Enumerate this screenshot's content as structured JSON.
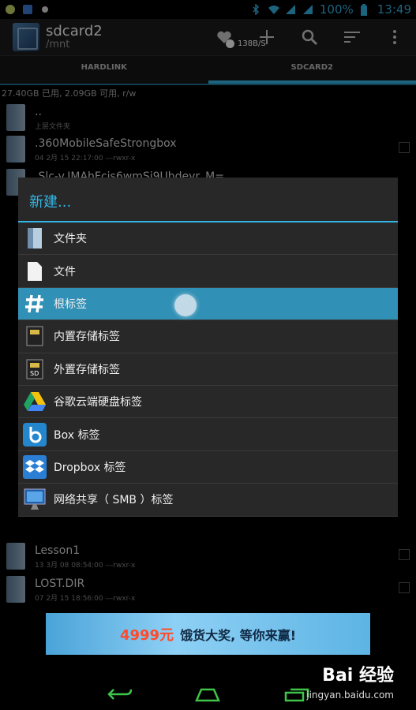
{
  "status_bar": {
    "battery_percent": "100%",
    "time": "13:49"
  },
  "action_bar": {
    "title": "sdcard2",
    "subtitle": "/mnt",
    "speed": "138B/S"
  },
  "tabs": [
    {
      "label": "HARDLINK",
      "active": false
    },
    {
      "label": "SDCARD2",
      "active": true
    }
  ],
  "storage_info": "27.40GB 已用, 2.09GB 可用, r/w",
  "files": [
    {
      "name": "..",
      "meta": "上层文件夹"
    },
    {
      "name": ".360MobileSafeStrongbox",
      "meta": "04 2月 15 22:17:00  ---rwxr-x"
    },
    {
      "name": ".Slc-v.IMAhFcis6wmSi9Uhdeyr_M=",
      "meta": ""
    },
    {
      "name": "Lesson1",
      "meta": "13 3月 08 08:54:00  ---rwxr-x"
    },
    {
      "name": "LOST.DIR",
      "meta": "07 2月 15 18:56:00  ---rwxr-x"
    }
  ],
  "dialog": {
    "title": "新建...",
    "items": [
      {
        "label": "文件夹",
        "icon": "folder-icon"
      },
      {
        "label": "文件",
        "icon": "file-icon"
      },
      {
        "label": "根标签",
        "icon": "hash-icon",
        "selected": true
      },
      {
        "label": "内置存储标签",
        "icon": "internal-storage-icon"
      },
      {
        "label": "外置存储标签",
        "icon": "sd-card-icon"
      },
      {
        "label": "谷歌云端硬盘标签",
        "icon": "google-drive-icon"
      },
      {
        "label": "Box 标签",
        "icon": "box-icon"
      },
      {
        "label": "Dropbox 标签",
        "icon": "dropbox-icon"
      },
      {
        "label": "网络共享（ SMB ）标签",
        "icon": "network-icon"
      }
    ]
  },
  "ad": {
    "price": "4999元",
    "text": "饿货大奖, 等你来赢!"
  },
  "watermark": {
    "brand": "Bai 经验",
    "url": "jingyan.baidu.com"
  },
  "colors": {
    "accent": "#33b5e5",
    "selected_row": "#3190b5"
  }
}
